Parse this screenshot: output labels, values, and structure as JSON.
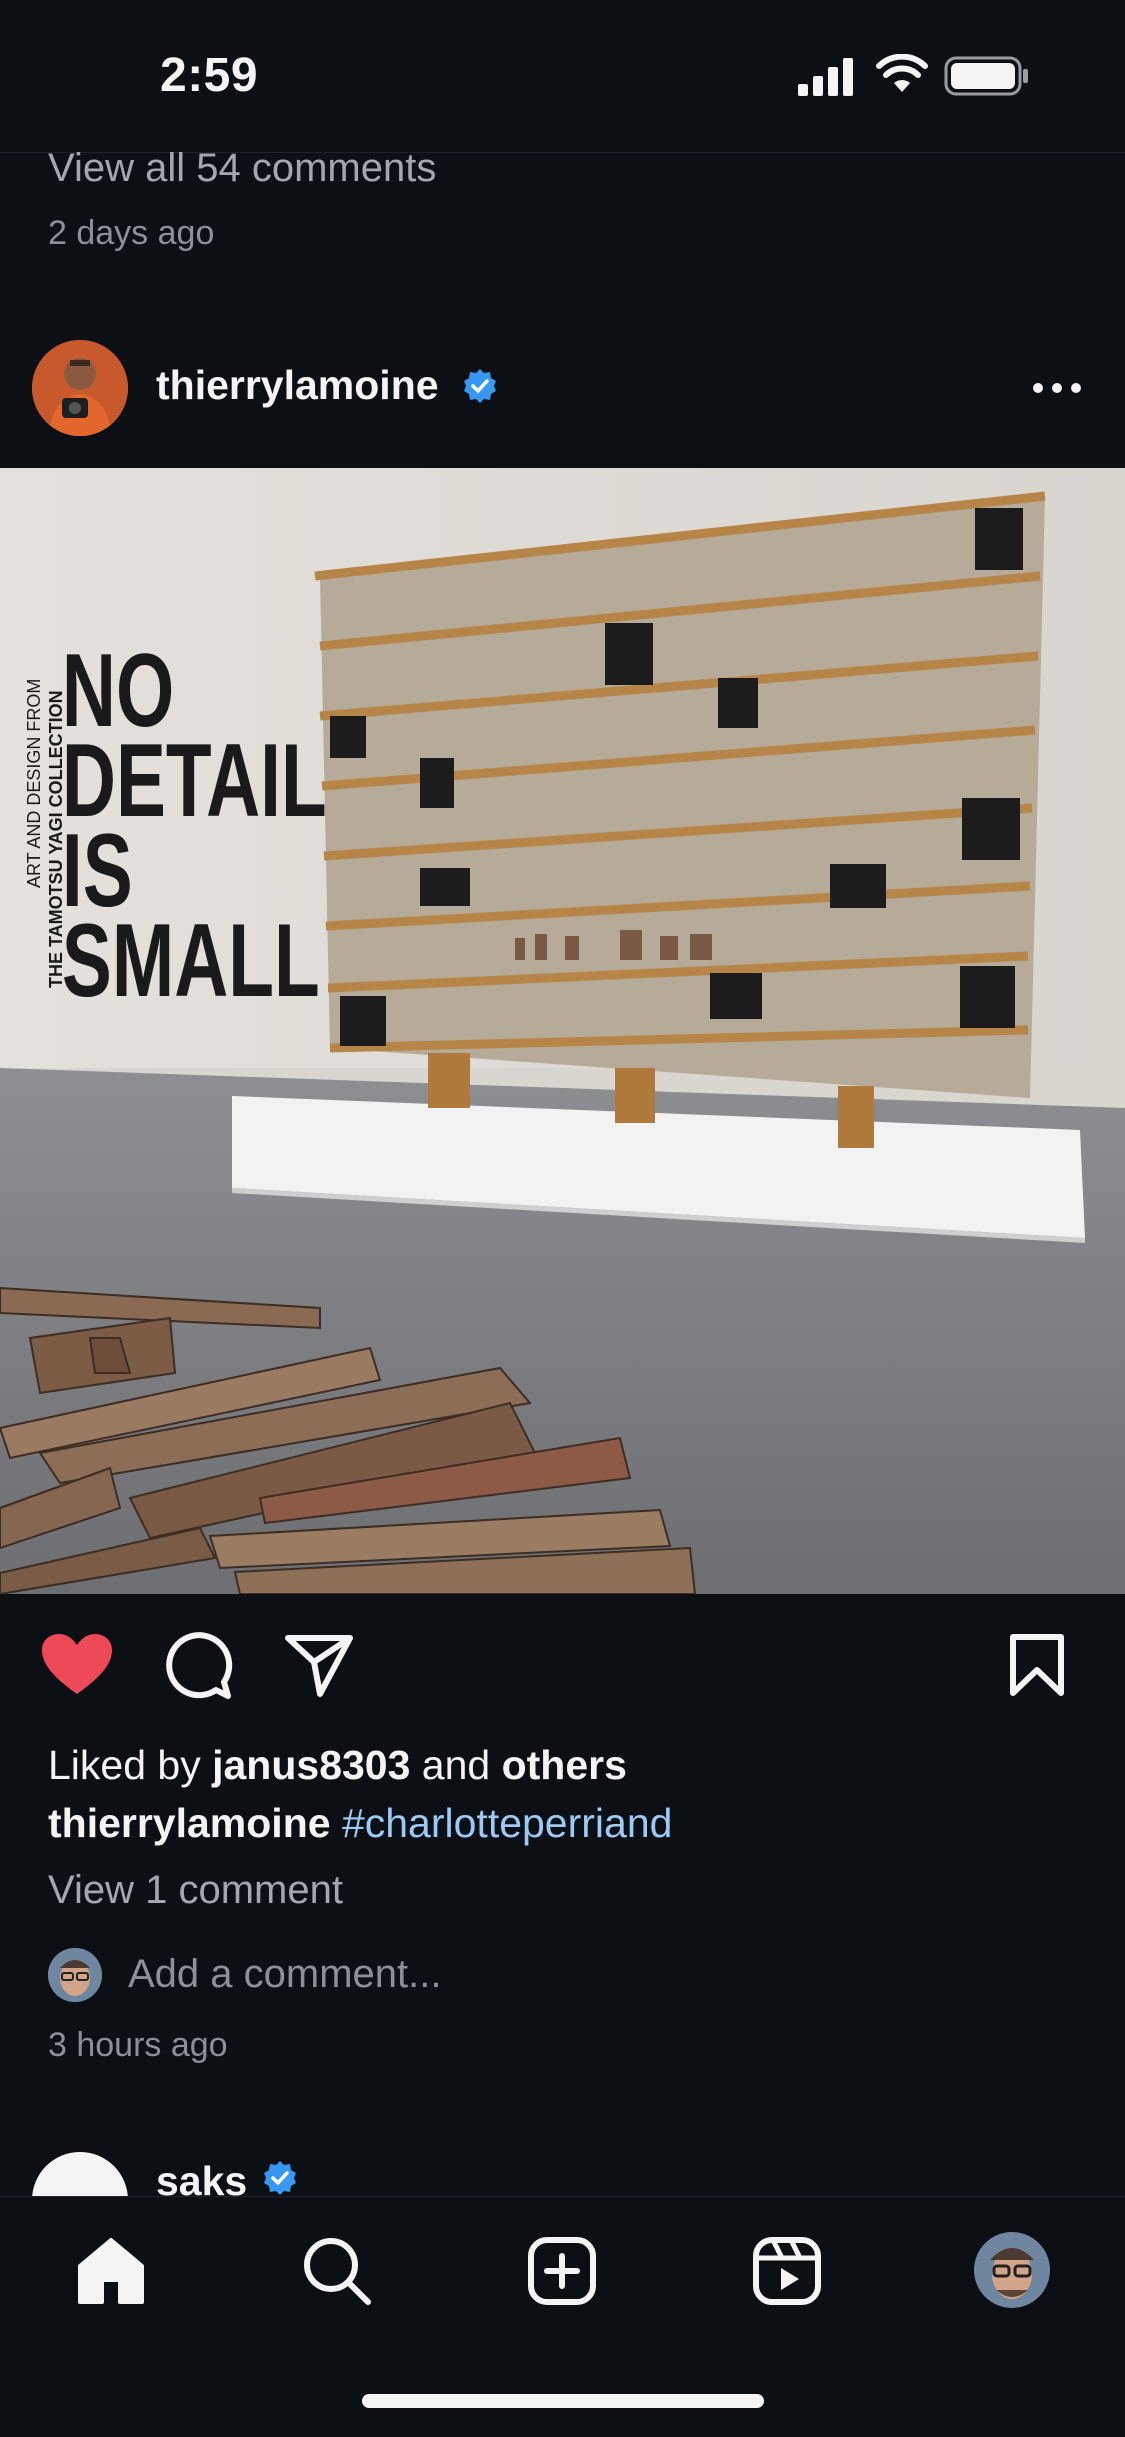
{
  "status_bar": {
    "time": "2:59",
    "icons": [
      "cellular-signal-icon",
      "wifi-icon",
      "battery-icon"
    ]
  },
  "previous_post": {
    "view_all_comments": "View all 54 comments",
    "time_ago": "2 days ago"
  },
  "post": {
    "username": "thierrylamoine",
    "verified": true,
    "liked_by_prefix": "Liked by ",
    "liked_by_user": "janus8303",
    "liked_by_and": " and ",
    "liked_by_others": "others",
    "caption_username": "thierrylamoine",
    "caption_tag": "#charlotteperriand",
    "view_comments": "View 1 comment",
    "add_comment_placeholder": "Add a comment...",
    "time_ago": "3 hours ago",
    "liked": true,
    "photo": {
      "wall_text_small_1": "ART AND DESIGN FROM",
      "wall_text_small_2": "THE TAMOTSU YAGI COLLECTION",
      "wall_text_big_1": "NO",
      "wall_text_big_2": "DETAIL",
      "wall_text_big_3": "IS",
      "wall_text_big_4": "SMALL"
    }
  },
  "next_post": {
    "username": "saks",
    "verified": true
  },
  "tab_bar": {
    "items": [
      "home-icon",
      "search-icon",
      "create-icon",
      "reels-icon",
      "profile-avatar"
    ]
  },
  "colors": {
    "background": "#0c0f14",
    "like_red": "#ed4956",
    "hashtag": "#9ccaf5",
    "verified_blue": "#3897f0"
  }
}
